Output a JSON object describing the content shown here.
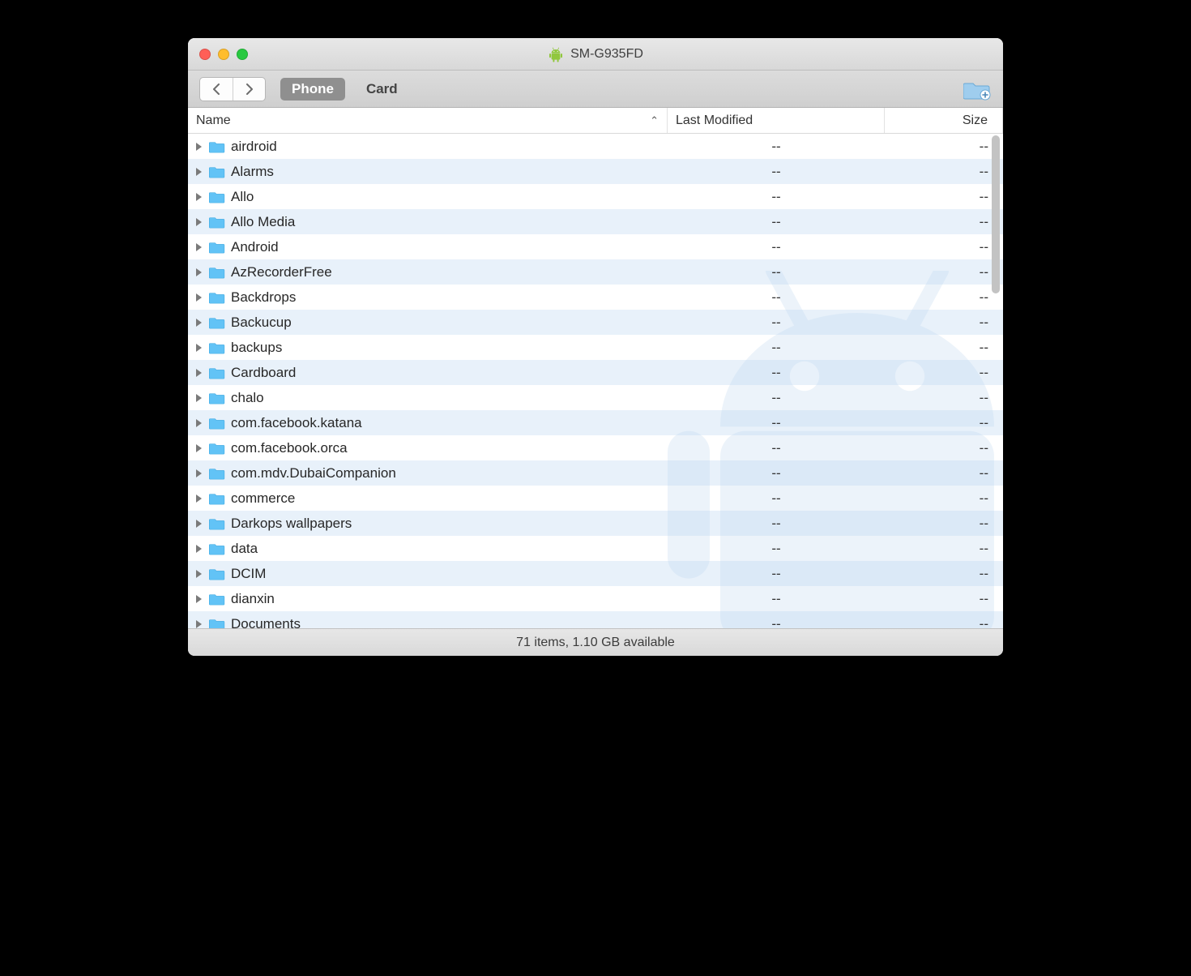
{
  "titlebar": {
    "title": "SM-G935FD"
  },
  "toolbar": {
    "phone_label": "Phone",
    "card_label": "Card"
  },
  "columns": {
    "name": "Name",
    "modified": "Last Modified",
    "size": "Size"
  },
  "files": [
    {
      "name": "airdroid",
      "modified": "--",
      "size": "--"
    },
    {
      "name": "Alarms",
      "modified": "--",
      "size": "--"
    },
    {
      "name": "Allo",
      "modified": "--",
      "size": "--"
    },
    {
      "name": "Allo Media",
      "modified": "--",
      "size": "--"
    },
    {
      "name": "Android",
      "modified": "--",
      "size": "--"
    },
    {
      "name": "AzRecorderFree",
      "modified": "--",
      "size": "--"
    },
    {
      "name": "Backdrops",
      "modified": "--",
      "size": "--"
    },
    {
      "name": "Backucup",
      "modified": "--",
      "size": "--"
    },
    {
      "name": "backups",
      "modified": "--",
      "size": "--"
    },
    {
      "name": "Cardboard",
      "modified": "--",
      "size": "--"
    },
    {
      "name": "chalo",
      "modified": "--",
      "size": "--"
    },
    {
      "name": "com.facebook.katana",
      "modified": "--",
      "size": "--"
    },
    {
      "name": "com.facebook.orca",
      "modified": "--",
      "size": "--"
    },
    {
      "name": "com.mdv.DubaiCompanion",
      "modified": "--",
      "size": "--"
    },
    {
      "name": "commerce",
      "modified": "--",
      "size": "--"
    },
    {
      "name": "Darkops wallpapers",
      "modified": "--",
      "size": "--"
    },
    {
      "name": "data",
      "modified": "--",
      "size": "--"
    },
    {
      "name": "DCIM",
      "modified": "--",
      "size": "--"
    },
    {
      "name": "dianxin",
      "modified": "--",
      "size": "--"
    },
    {
      "name": "Documents",
      "modified": "--",
      "size": "--"
    }
  ],
  "status": {
    "text": "71 items, 1.10 GB available"
  }
}
